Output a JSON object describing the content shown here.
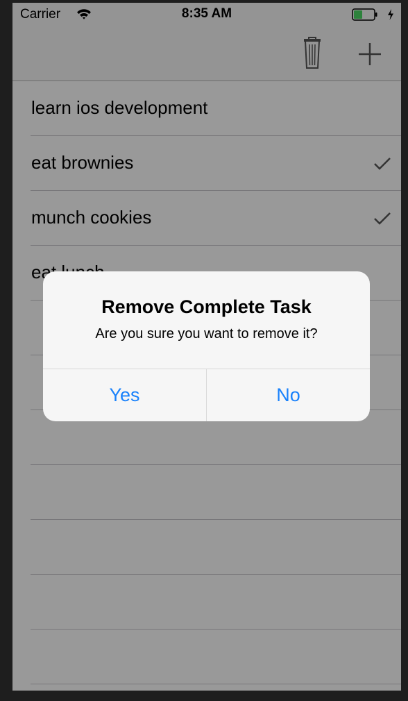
{
  "status_bar": {
    "carrier": "Carrier",
    "time": "8:35 AM"
  },
  "nav_bar": {
    "trash_icon": "trash-icon",
    "add_icon": "plus-icon"
  },
  "tasks": [
    {
      "title": "learn ios development",
      "completed": false
    },
    {
      "title": "eat brownies",
      "completed": true
    },
    {
      "title": "munch cookies",
      "completed": true
    },
    {
      "title": "eat lunch",
      "completed": false
    },
    {
      "title": "",
      "completed": false
    },
    {
      "title": "",
      "completed": false
    },
    {
      "title": "",
      "completed": false
    },
    {
      "title": "",
      "completed": false
    },
    {
      "title": "",
      "completed": false
    },
    {
      "title": "",
      "completed": false
    },
    {
      "title": "",
      "completed": false
    }
  ],
  "alert": {
    "title": "Remove Complete Task",
    "message": "Are you sure you want to remove it?",
    "yes_label": "Yes",
    "no_label": "No"
  },
  "colors": {
    "accent": "#1a82fb",
    "battery": "#4cd964"
  }
}
